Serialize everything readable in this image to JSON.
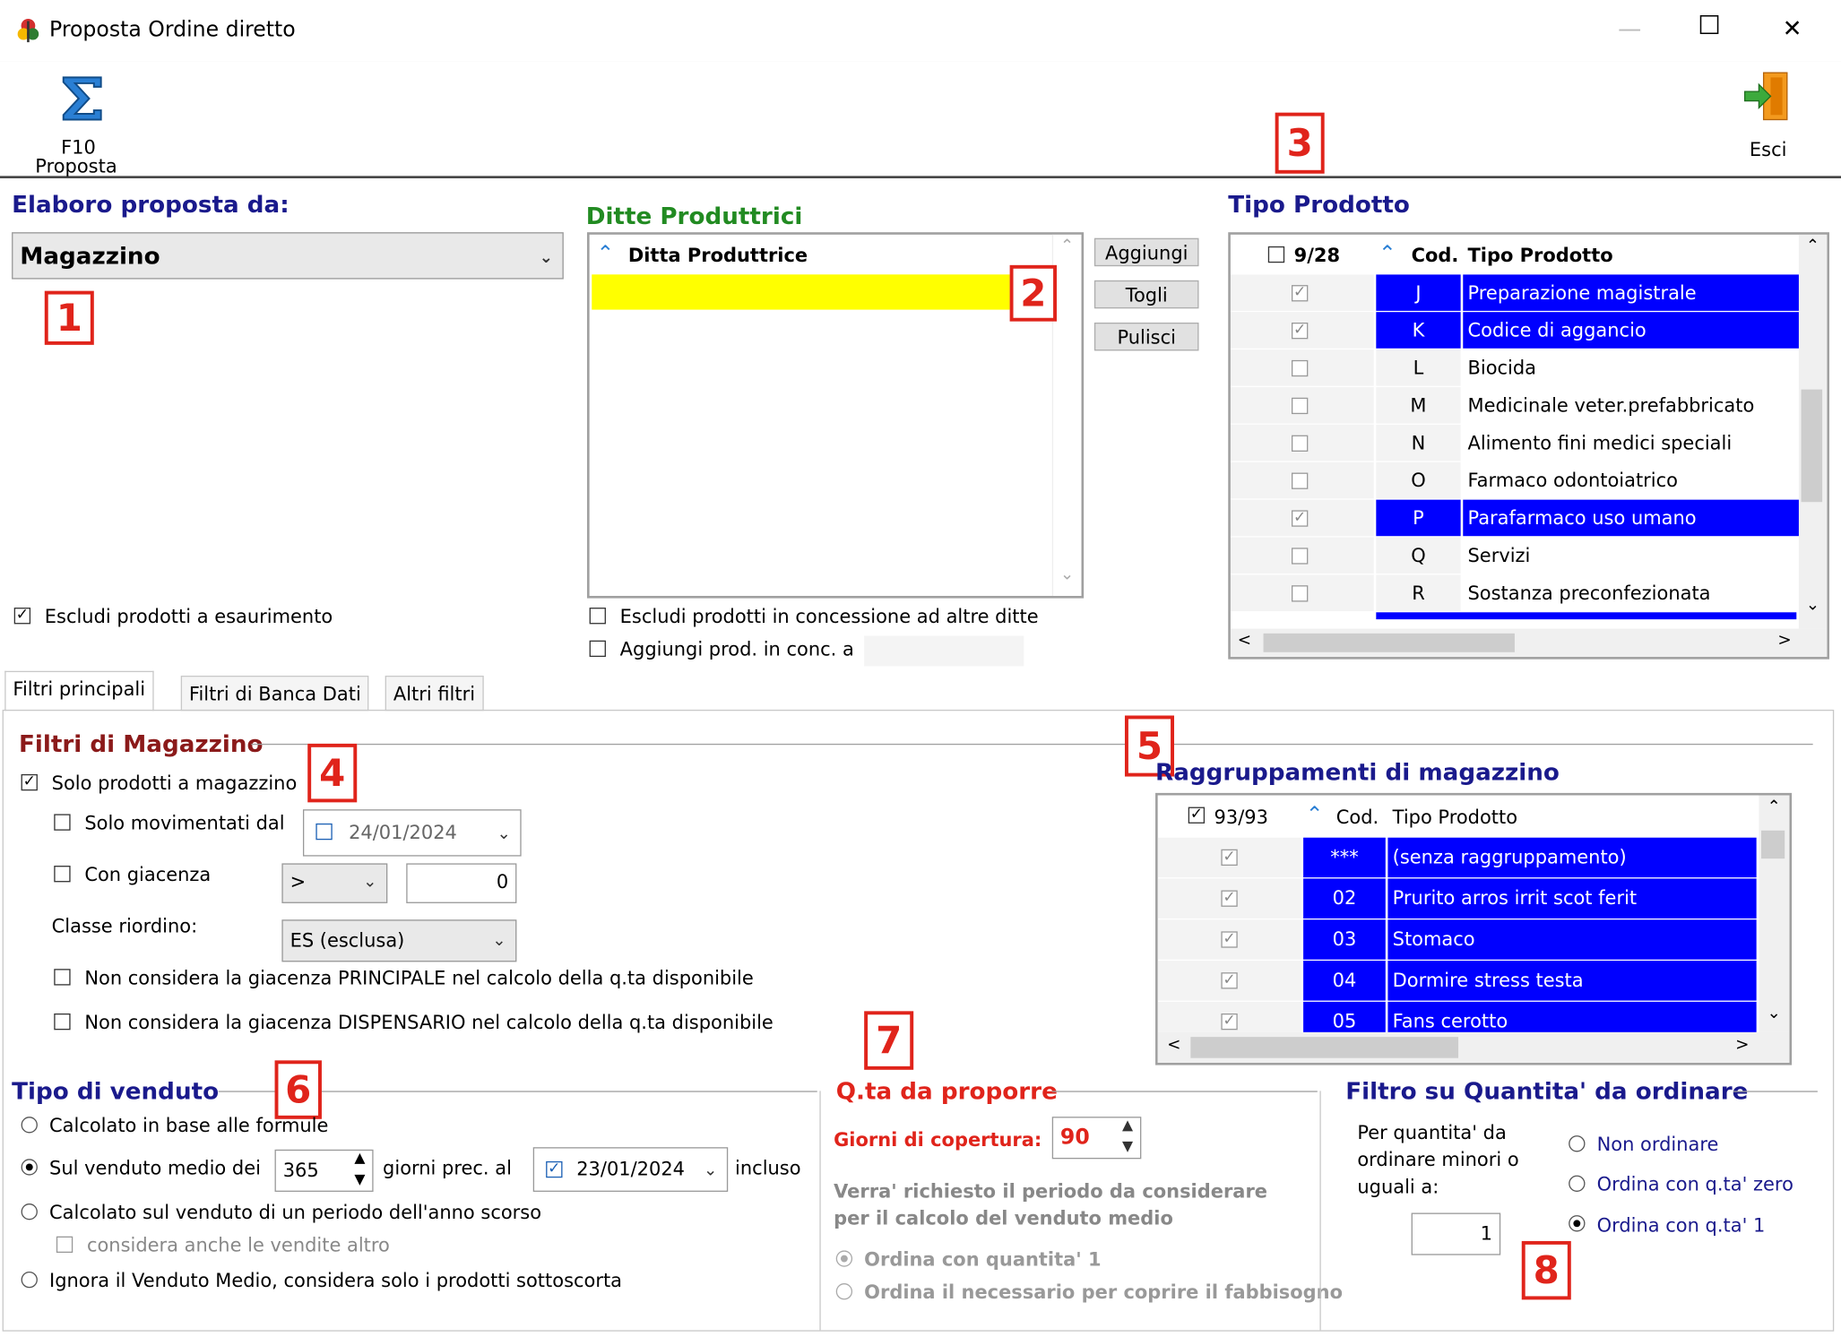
{
  "window": {
    "title": "Proposta Ordine diretto",
    "minimize": "—",
    "maximize": "☐",
    "close": "✕"
  },
  "toolbar": {
    "proposta_key": "F10",
    "proposta_label": "Proposta",
    "esci_label": "Esci"
  },
  "markers": [
    "1",
    "2",
    "3",
    "4",
    "5",
    "6",
    "7",
    "8"
  ],
  "elaboro": {
    "heading": "Elaboro proposta da:",
    "selected": "Magazzino",
    "escludi_esaurimento": "Escludi prodotti a esaurimento"
  },
  "ditte": {
    "heading": "Ditte Produttrici",
    "column": "Ditta Produttrice",
    "btn_aggiungi": "Aggiungi",
    "btn_togli": "Togli",
    "btn_pulisci": "Pulisci",
    "escludi_concessione": "Escludi prodotti in concessione ad altre ditte",
    "aggiungi_conc": "Aggiungi prod. in conc. a"
  },
  "tipo_prodotto": {
    "heading": "Tipo Prodotto",
    "count": "9/28",
    "col_cod": "Cod.",
    "col_tipo": "Tipo Prodotto",
    "rows": [
      {
        "checked": true,
        "cod": "J",
        "label": "Preparazione magistrale",
        "selected": true
      },
      {
        "checked": true,
        "cod": "K",
        "label": "Codice di aggancio",
        "selected": true
      },
      {
        "checked": false,
        "cod": "L",
        "label": "Biocida",
        "selected": false
      },
      {
        "checked": false,
        "cod": "M",
        "label": "Medicinale veter.prefabbricato",
        "selected": false
      },
      {
        "checked": false,
        "cod": "N",
        "label": "Alimento fini medici speciali",
        "selected": false
      },
      {
        "checked": false,
        "cod": "O",
        "label": "Farmaco odontoiatrico",
        "selected": false
      },
      {
        "checked": true,
        "cod": "P",
        "label": "Parafarmaco uso umano",
        "selected": true
      },
      {
        "checked": false,
        "cod": "Q",
        "label": "Servizi",
        "selected": false
      },
      {
        "checked": false,
        "cod": "R",
        "label": "Sostanza preconfezionata",
        "selected": false
      }
    ]
  },
  "tabs": [
    "Filtri principali",
    "Filtri di Banca Dati",
    "Altri filtri"
  ],
  "filtri_magazzino": {
    "heading": "Filtri di Magazzino",
    "solo_magazzino": "Solo prodotti a magazzino",
    "solo_movimentati": "Solo movimentati dal",
    "movimentati_date": "24/01/2024",
    "con_giacenza": "Con giacenza",
    "giacenza_op": ">",
    "giacenza_value": "0",
    "classe_label": "Classe riordino:",
    "classe_value": "ES (esclusa)",
    "non_principale": "Non considera la giacenza PRINCIPALE nel calcolo della q.ta disponibile",
    "non_dispensario": "Non considera la giacenza DISPENSARIO nel calcolo della q.ta disponibile"
  },
  "raggruppamenti": {
    "heading": "Raggruppamenti di magazzino",
    "count": "93/93",
    "col_cod": "Cod.",
    "col_tipo": "Tipo Prodotto",
    "rows": [
      {
        "cod": "***",
        "label": "(senza raggruppamento)"
      },
      {
        "cod": "02",
        "label": "Prurito arros irrit scot ferit"
      },
      {
        "cod": "03",
        "label": "Stomaco"
      },
      {
        "cod": "04",
        "label": "Dormire stress testa"
      },
      {
        "cod": "05",
        "label": "Fans cerotto"
      }
    ]
  },
  "tipo_venduto": {
    "heading": "Tipo di venduto",
    "opt_formule": "Calcolato in base alle formule",
    "opt_medio": "Sul venduto medio dei",
    "giorni_value": "365",
    "giorni_prec": "giorni prec. al",
    "data_value": "23/01/2024",
    "incluso": "incluso",
    "opt_anno_scorso": "Calcolato sul venduto di un periodo dell'anno scorso",
    "considera_altro": "considera anche le vendite altro",
    "opt_ignora": "Ignora il Venduto Medio, considera solo i prodotti sottoscorta"
  },
  "qta_proporre": {
    "heading": "Q.ta da proporre",
    "giorni_label": "Giorni di copertura:",
    "giorni_value": "90",
    "nota": "Verra' richiesto il periodo da considerare per il calcolo del venduto medio",
    "ordina_uno": "Ordina con quantita' 1",
    "ordina_necessario": "Ordina il necessario per coprire il fabbisogno"
  },
  "filtro_quantita": {
    "heading": "Filtro su Quantita' da ordinare",
    "desc": "Per quantita' da ordinare minori o uguali a:",
    "value": "1",
    "opt_non_ordinare": "Non ordinare",
    "opt_zero": "Ordina con q.ta' zero",
    "opt_uno": "Ordina con q.ta' 1"
  },
  "colors": {
    "selection": "#0000ff",
    "heading_blue": "#1a1a8c",
    "heading_green": "#228b22",
    "heading_red": "#8b1a1a",
    "marker_red": "#e0241b",
    "highlight_yellow": "#ffff00"
  }
}
